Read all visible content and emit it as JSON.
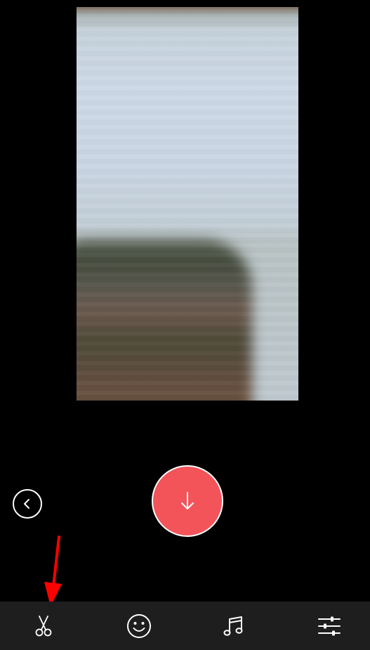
{
  "screen": {
    "background_color": "#000000"
  },
  "preview": {
    "icon": "blurred-photo-preview"
  },
  "controls": {
    "back_icon": "chevron-left-icon",
    "download_icon": "arrow-down-icon",
    "download_color": "#f2545a"
  },
  "annotation": {
    "icon": "red-arrow-pointer",
    "color": "#ff0000"
  },
  "toolbar": {
    "background_color": "#1e1e1e",
    "items": [
      {
        "icon": "scissors-icon"
      },
      {
        "icon": "smiley-icon"
      },
      {
        "icon": "music-note-icon"
      },
      {
        "icon": "sliders-icon"
      }
    ]
  }
}
